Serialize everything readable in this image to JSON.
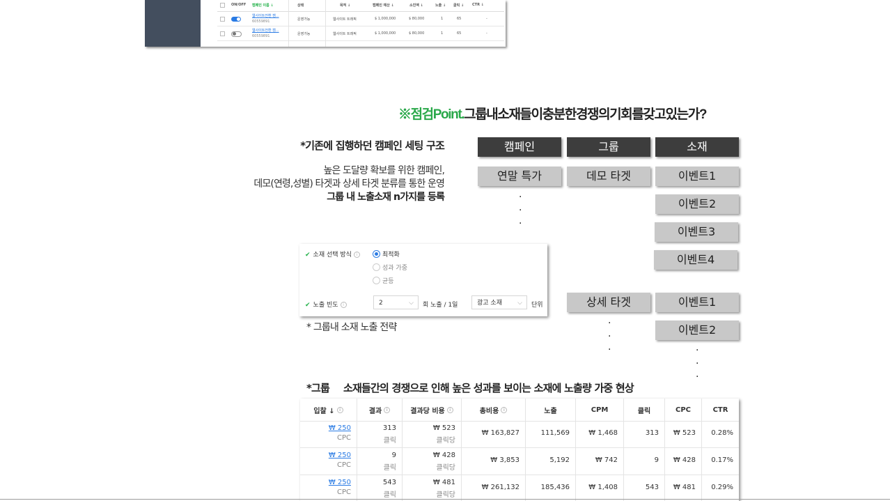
{
  "top_table": {
    "headers": [
      "ON/OFF",
      "캠페인 이름 ↓",
      "상태",
      "목적 ↓",
      "캠페인 예산 ↓",
      "소진액 ↓",
      "노출 ↓",
      "클릭 ↓",
      "CTR ↓"
    ],
    "rows": [
      {
        "toggle": "on",
        "name": "웹사이트전환 캠...",
        "id": "60559891",
        "status": "운영가능",
        "goal": "웹사이트 트래픽",
        "budget": "$ 1,000,000",
        "spend": "$ 80,000",
        "impr": "1",
        "clicks": "65",
        "ctr": "-"
      },
      {
        "toggle": "off",
        "name": "웹사이트전환 캠...",
        "id": "60559891",
        "status": "운영가능",
        "goal": "웹사이트 트래픽",
        "budget": "$ 1,000,000",
        "spend": "$ 80,000",
        "impr": "1",
        "clicks": "65",
        "ctr": "-"
      }
    ]
  },
  "headline": {
    "mark": "※점검Point.",
    "text": "그룹내소재들이충분한경쟁의기회를갖고있는가?"
  },
  "structure": {
    "title": "*기존에 집행하던 캠페인 세팅 구조",
    "line1": "높은 도달량 확보를 위한 캠페인,",
    "line2": "데모(연령,성별) 타겟과 상세 타겟 분류를 통한 운영",
    "line3": "그룹 내 노출소재 n가지를 등록"
  },
  "boxes": {
    "campaign": "캠페인",
    "group": "그룹",
    "creative": "소재",
    "campaign_1": "연말 특가",
    "group_1": "데모 타겟",
    "group_2": "상세 타겟",
    "event1": "이벤트1",
    "event2": "이벤트2",
    "event3": "이벤트3",
    "event4": "이벤트4",
    "dot": "."
  },
  "settings": {
    "selection_label": "소재 선택 방식",
    "options": [
      "최적화",
      "성과 가중",
      "균등"
    ],
    "selected": "최적화",
    "freq_label": "노출 빈도",
    "freq_value": "2",
    "freq_unit": "회 노출 / 1일",
    "unit_value": "광고 소재",
    "unit_suffix": "단위",
    "check": "✔",
    "info": "i",
    "chevron": "⌵"
  },
  "caption": "* 그룹내 소재 노출 전략",
  "phenomenon": {
    "prefix": "*그룹",
    "text": "소재들간의 경쟁으로 인해 높은 성과를 보이는 소재에 노출량 가중 현상"
  },
  "bottom_table": {
    "headers": [
      "입찰 ↓",
      "결과",
      "결과당 비용",
      "총비용",
      "노출",
      "CPM",
      "클릭",
      "CPC",
      "CTR"
    ],
    "rows": [
      {
        "bid": "₩ 250",
        "bid_sub": "CPC",
        "result": "313",
        "result_sub": "클릭",
        "cpr": "₩ 523",
        "cpr_sub": "클릭당",
        "total": "₩ 163,827",
        "impr": "111,569",
        "cpm": "₩ 1,468",
        "clicks": "313",
        "cpc": "₩ 523",
        "ctr": "0.28%"
      },
      {
        "bid": "₩ 250",
        "bid_sub": "CPC",
        "result": "9",
        "result_sub": "클릭",
        "cpr": "₩ 428",
        "cpr_sub": "클릭당",
        "total": "₩ 3,853",
        "impr": "5,192",
        "cpm": "₩ 742",
        "clicks": "9",
        "cpc": "₩ 428",
        "ctr": "0.17%"
      },
      {
        "bid": "₩ 250",
        "bid_sub": "CPC",
        "result": "543",
        "result_sub": "클릭",
        "cpr": "₩ 481",
        "cpr_sub": "클릭당",
        "total": "₩ 261,132",
        "impr": "185,436",
        "cpm": "₩ 1,408",
        "clicks": "543",
        "cpc": "₩ 481",
        "ctr": "0.29%"
      }
    ]
  },
  "colors": {
    "accent_green": "#24b24a",
    "link_blue": "#2a7be4",
    "dark_box": "#3d3d3d",
    "light_box": "#c8c8c8"
  }
}
